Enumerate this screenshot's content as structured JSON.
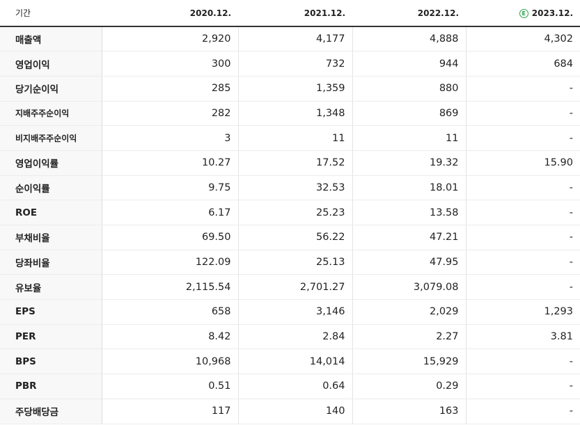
{
  "header": {
    "period_label": "기간",
    "columns": [
      "2020.12.",
      "2021.12.",
      "2022.12.",
      "2023.12."
    ],
    "estimate_icon_glyph": "E",
    "estimate_color": "#2aa24a"
  },
  "rows": [
    {
      "label": "매출액",
      "values": [
        "2,920",
        "4,177",
        "4,888",
        "4,302"
      ]
    },
    {
      "label": "영업이익",
      "values": [
        "300",
        "732",
        "944",
        "684"
      ]
    },
    {
      "label": "당기순이익",
      "values": [
        "285",
        "1,359",
        "880",
        "-"
      ]
    },
    {
      "label": "지배주주순이익",
      "values": [
        "282",
        "1,348",
        "869",
        "-"
      ]
    },
    {
      "label": "비지배주주순이익",
      "values": [
        "3",
        "11",
        "11",
        "-"
      ]
    },
    {
      "label": "영업이익률",
      "values": [
        "10.27",
        "17.52",
        "19.32",
        "15.90"
      ]
    },
    {
      "label": "순이익률",
      "values": [
        "9.75",
        "32.53",
        "18.01",
        "-"
      ]
    },
    {
      "label": "ROE",
      "values": [
        "6.17",
        "25.23",
        "13.58",
        "-"
      ]
    },
    {
      "label": "부채비율",
      "values": [
        "69.50",
        "56.22",
        "47.21",
        "-"
      ]
    },
    {
      "label": "당좌비율",
      "values": [
        "122.09",
        "25.13",
        "47.95",
        "-"
      ]
    },
    {
      "label": "유보율",
      "values": [
        "2,115.54",
        "2,701.27",
        "3,079.08",
        "-"
      ]
    },
    {
      "label": "EPS",
      "values": [
        "658",
        "3,146",
        "2,029",
        "1,293"
      ]
    },
    {
      "label": "PER",
      "values": [
        "8.42",
        "2.84",
        "2.27",
        "3.81"
      ]
    },
    {
      "label": "BPS",
      "values": [
        "10,968",
        "14,014",
        "15,929",
        "-"
      ]
    },
    {
      "label": "PBR",
      "values": [
        "0.51",
        "0.64",
        "0.29",
        "-"
      ]
    },
    {
      "label": "주당배당금",
      "values": [
        "117",
        "140",
        "163",
        "-"
      ]
    }
  ]
}
